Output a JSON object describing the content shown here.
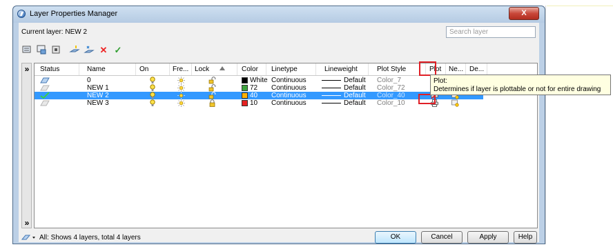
{
  "window": {
    "title": "Layer Properties Manager",
    "close_label": "X"
  },
  "current_layer": {
    "label": "Current layer: NEW 2"
  },
  "search": {
    "placeholder": "Search layer"
  },
  "columns": [
    "Status",
    "Name",
    "On",
    "Fre...",
    "Lock",
    "Color",
    "Linetype",
    "Lineweight",
    "Plot Style",
    "Plot",
    "Ne...",
    "De..."
  ],
  "rows": [
    {
      "name": "0",
      "color_name": "White",
      "color_hex": "#000000",
      "linetype": "Continuous",
      "lineweight": "Default",
      "plot_style": "Color_7",
      "selected": false,
      "current": false
    },
    {
      "name": "NEW 1",
      "color_name": "72",
      "color_hex": "#3fa33f",
      "linetype": "Continuous",
      "lineweight": "Default",
      "plot_style": "Color_72",
      "selected": false,
      "current": false
    },
    {
      "name": "NEW 2",
      "color_name": "40",
      "color_hex": "#ffb000",
      "linetype": "Continuous",
      "lineweight": "Default",
      "plot_style": "Color_40",
      "selected": true,
      "current": true
    },
    {
      "name": "NEW 3",
      "color_name": "10",
      "color_hex": "#e52222",
      "linetype": "Continuous",
      "lineweight": "Default",
      "plot_style": "Color_10",
      "selected": false,
      "current": false
    }
  ],
  "tooltip": {
    "title": "Plot:",
    "text": "Determines if layer is plottable or not for entire drawing"
  },
  "footer": {
    "status": "All: Shows 4 layers, total 4 layers"
  },
  "buttons": {
    "ok": "OK",
    "cancel": "Cancel",
    "apply": "Apply",
    "help": "Help"
  },
  "toolbar_icons": [
    "new-property-filter-icon",
    "new-group-filter-icon",
    "layer-states-manager-icon",
    "new-layer-icon",
    "new-layer-vp-frozen-icon",
    "delete-layer-icon",
    "set-current-icon"
  ],
  "colors": {
    "selection": "#3399ff",
    "highlight": "#e01f26",
    "tooltip_bg": "#ffffe1"
  }
}
